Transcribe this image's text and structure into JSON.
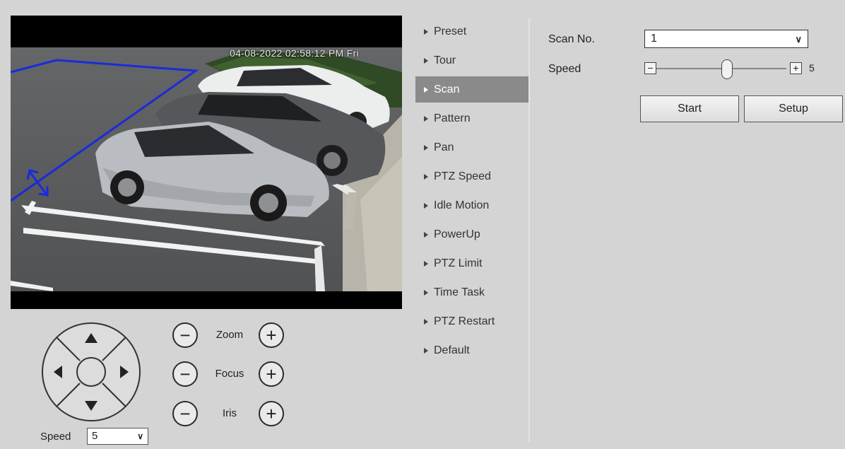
{
  "video": {
    "timestamp": "04-08-2022 02:58:12 PM Fri"
  },
  "ptz": {
    "directions": [
      "up-arrow-icon",
      "down-arrow-icon",
      "left-arrow-icon",
      "right-arrow-icon",
      "center-icon"
    ],
    "zoom_label": "Zoom",
    "focus_label": "Focus",
    "iris_label": "Iris",
    "minus_symbol": "−",
    "plus_symbol": "+",
    "speed_label": "Speed",
    "speed_value": "5"
  },
  "menu": {
    "items": [
      {
        "label": "Preset"
      },
      {
        "label": "Tour"
      },
      {
        "label": "Scan"
      },
      {
        "label": "Pattern"
      },
      {
        "label": "Pan"
      },
      {
        "label": "PTZ Speed"
      },
      {
        "label": "Idle Motion"
      },
      {
        "label": "PowerUp"
      },
      {
        "label": "PTZ Limit"
      },
      {
        "label": "Time Task"
      },
      {
        "label": "PTZ Restart"
      },
      {
        "label": "Default"
      }
    ],
    "active": "Scan"
  },
  "scan": {
    "scan_no_label": "Scan No.",
    "scan_no_value": "1",
    "speed_label": "Speed",
    "speed_value": "5",
    "speed_fraction": 0.5,
    "start_label": "Start",
    "setup_label": "Setup"
  },
  "colors": {
    "background": "#d4d4d4",
    "menu_active": "#8a8a8a",
    "overlay_line": "#1a2bdc"
  }
}
